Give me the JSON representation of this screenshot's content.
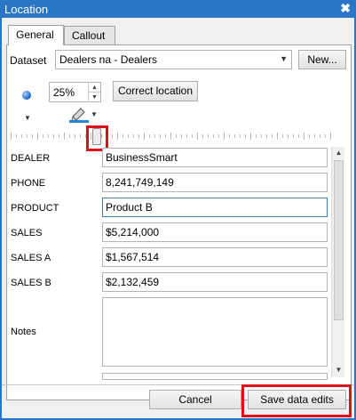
{
  "window": {
    "title": "Location",
    "close_glyph": "✖"
  },
  "tabs": [
    {
      "label": "General"
    },
    {
      "label": "Callout"
    }
  ],
  "dataset": {
    "label": "Dataset",
    "value": "Dealers na - Dealers",
    "new_button": "New..."
  },
  "toolbar": {
    "zoom_value": "25%",
    "correct_location_button": "Correct location",
    "marker_icon": "blue-sphere-icon",
    "pen_icon": "pencil-icon",
    "slider_level": 0.26
  },
  "fields": [
    {
      "label": "DEALER",
      "value": "BusinessSmart"
    },
    {
      "label": "PHONE",
      "value": "8,241,749,149"
    },
    {
      "label": "PRODUCT",
      "value": "Product B"
    },
    {
      "label": "SALES",
      "value": "$5,214,000"
    },
    {
      "label": "SALES A",
      "value": "$1,567,514"
    },
    {
      "label": "SALES B",
      "value": "$2,132,459"
    },
    {
      "label": "Notes",
      "value": ""
    }
  ],
  "buttons": {
    "cancel": "Cancel",
    "save": "Save data edits"
  },
  "colors": {
    "titlebar": "#2b75c7",
    "highlight": "#e0101a",
    "pen_underline": "#1e88d8"
  }
}
